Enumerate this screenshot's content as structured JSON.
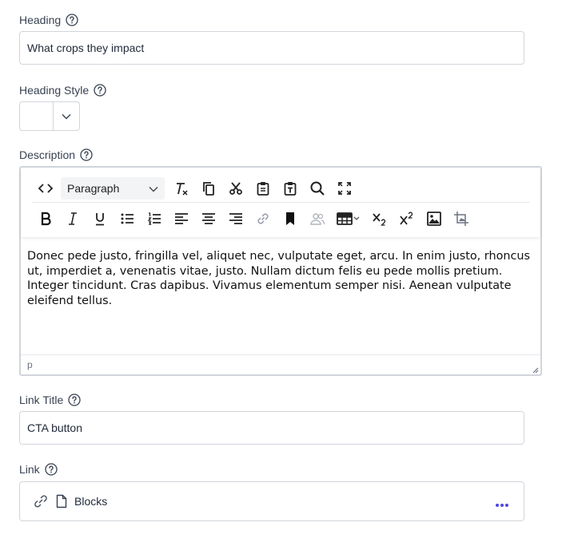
{
  "heading": {
    "label": "Heading",
    "value": "What crops they impact"
  },
  "heading_style": {
    "label": "Heading Style",
    "value": ""
  },
  "description": {
    "label": "Description",
    "format_select": "Paragraph",
    "content": "Donec pede justo, fringilla vel, aliquet nec, vulputate eget, arcu. In enim justo, rhoncus ut, imperdiet a, venenatis vitae, justo. Nullam dictum felis eu pede mollis pretium. Integer tincidunt. Cras dapibus. Vivamus elementum semper nisi. Aenean vulputate eleifend tellus.",
    "path": "p",
    "toolbar_row1": [
      "source-code-icon",
      "clear-formatting-icon",
      "copy-icon",
      "cut-icon",
      "paste-icon",
      "paste-as-text-icon",
      "search-icon",
      "fullscreen-icon"
    ],
    "toolbar_row2": [
      "bold-icon",
      "italic-icon",
      "underline-icon",
      "bullet-list-icon",
      "numbered-list-icon",
      "align-left-icon",
      "align-center-icon",
      "align-right-icon",
      "link-icon",
      "bookmark-icon",
      "users-icon",
      "table-icon",
      "subscript-icon",
      "superscript-icon",
      "image-icon",
      "crop-icon"
    ]
  },
  "link_title": {
    "label": "Link Title",
    "value": "CTA button"
  },
  "link": {
    "label": "Link",
    "value": "Blocks"
  },
  "colors": {
    "border": "#d1d5db",
    "text": "#1f2937",
    "accent": "#4f46e5"
  }
}
